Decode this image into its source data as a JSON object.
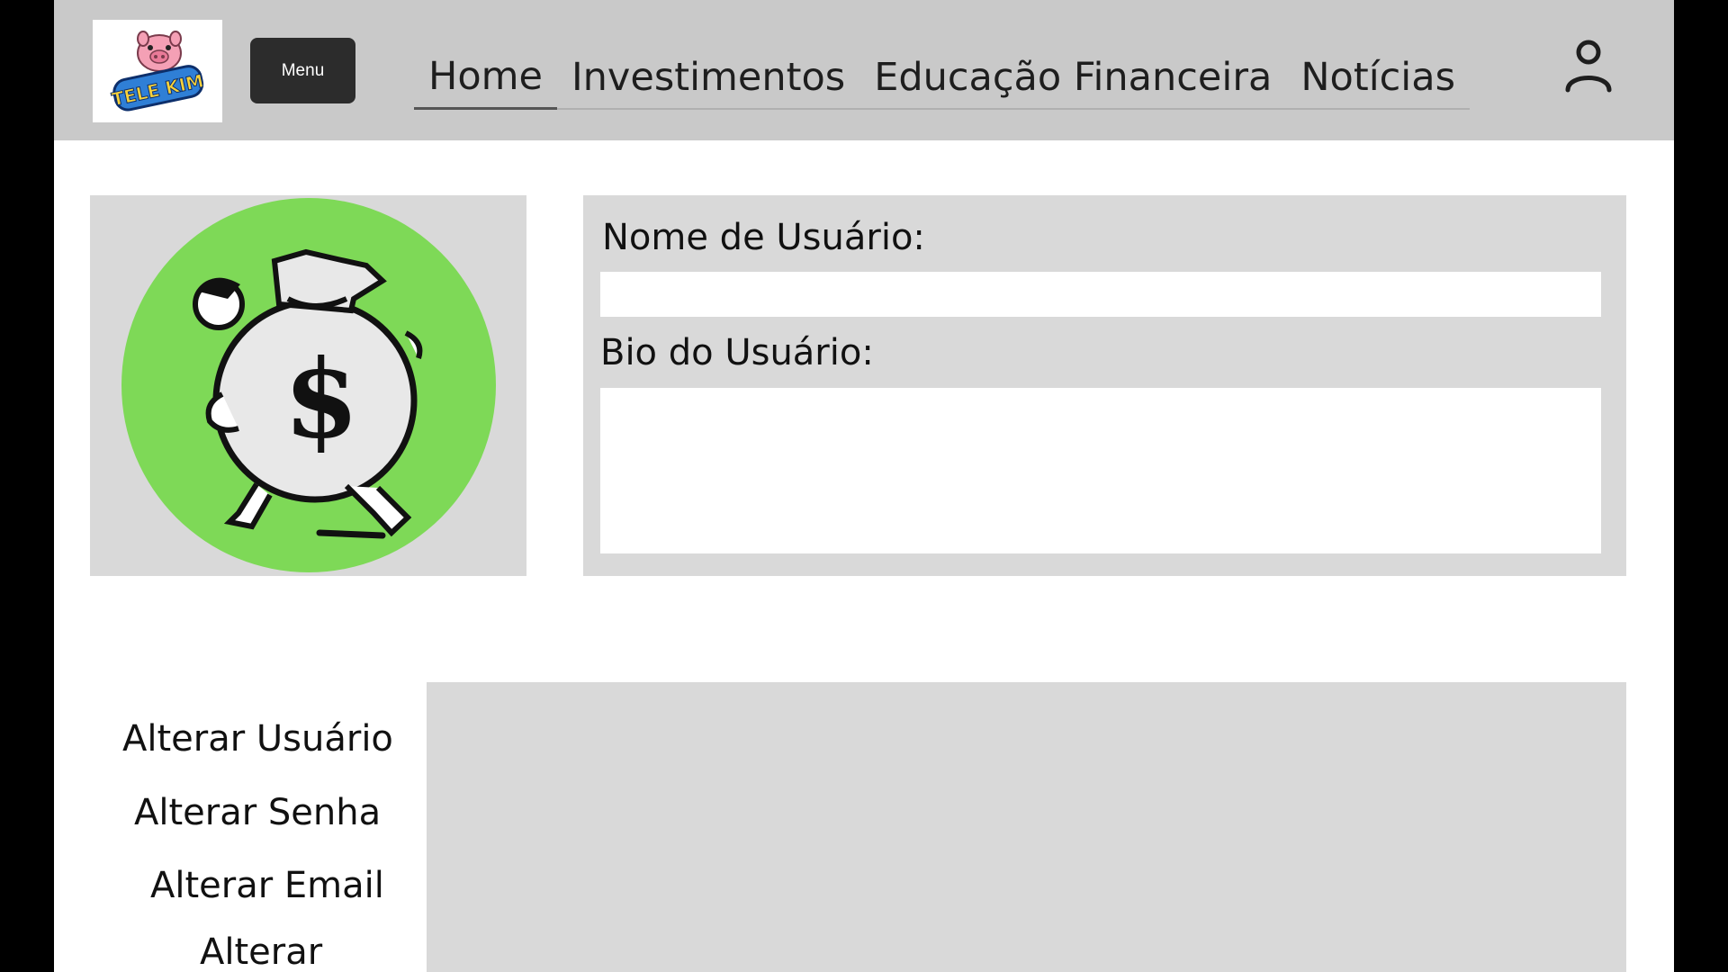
{
  "header": {
    "logo_text": "TELE KIM",
    "menu_button_label": "Menu",
    "nav": [
      {
        "label": "Home",
        "active": true
      },
      {
        "label": "Investimentos",
        "active": false
      },
      {
        "label": "Educação Financeira",
        "active": false
      },
      {
        "label": "Notícias",
        "active": false
      }
    ],
    "user_icon": "user-icon"
  },
  "profile": {
    "avatar_icon": "money-bag-man-illustration",
    "avatar_bg_color": "#7ed957",
    "username_label": "Nome de Usuário:",
    "username_value": "",
    "bio_label": "Bio do Usuário:",
    "bio_value": ""
  },
  "settings_menu": {
    "items": [
      {
        "label": "Alterar Usuário"
      },
      {
        "label": "Alterar Senha"
      },
      {
        "label": "Alterar Email"
      },
      {
        "label": "Alterar"
      }
    ]
  },
  "colors": {
    "header_bg": "#c9c9c9",
    "panel_bg": "#d9d9d9",
    "menu_button_bg": "#2c2c2c"
  }
}
